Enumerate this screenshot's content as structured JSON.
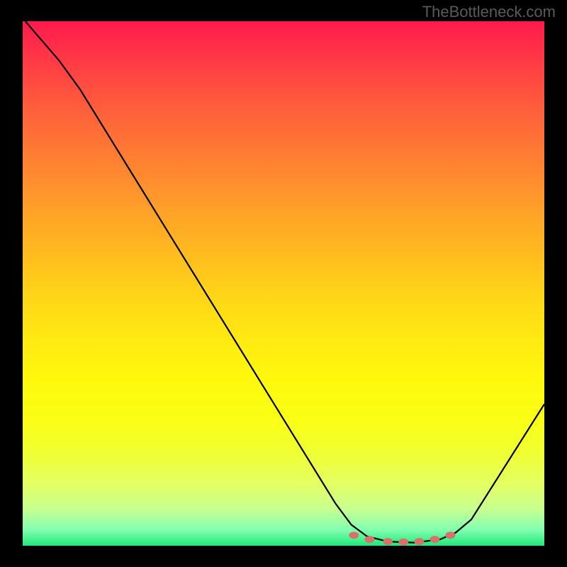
{
  "watermark": "TheBottleneck.com",
  "chart_data": {
    "type": "line",
    "title": "",
    "xlabel": "",
    "ylabel": "",
    "xlim": [
      0,
      100
    ],
    "ylim": [
      0,
      100
    ],
    "series": [
      {
        "name": "curve",
        "points": [
          {
            "x": 0.5,
            "y": 100
          },
          {
            "x": 7,
            "y": 92.5
          },
          {
            "x": 11,
            "y": 87
          },
          {
            "x": 60,
            "y": 8
          },
          {
            "x": 63,
            "y": 4
          },
          {
            "x": 66,
            "y": 1.8
          },
          {
            "x": 70,
            "y": 0.8
          },
          {
            "x": 75,
            "y": 0.6
          },
          {
            "x": 80,
            "y": 1.2
          },
          {
            "x": 83,
            "y": 2.5
          },
          {
            "x": 86,
            "y": 5
          },
          {
            "x": 100,
            "y": 27
          }
        ]
      }
    ],
    "markers": [
      {
        "x": 63.5,
        "y": 2.0
      },
      {
        "x": 66.5,
        "y": 1.2
      },
      {
        "x": 70,
        "y": 0.8
      },
      {
        "x": 73,
        "y": 0.7
      },
      {
        "x": 76,
        "y": 0.8
      },
      {
        "x": 79,
        "y": 1.2
      },
      {
        "x": 82,
        "y": 2.0
      }
    ],
    "colors": {
      "curve": "#000000",
      "markers": "#d9716b",
      "gradient_top": "#ff1a4d",
      "gradient_mid": "#ffe812",
      "gradient_bottom": "#20e878"
    }
  }
}
